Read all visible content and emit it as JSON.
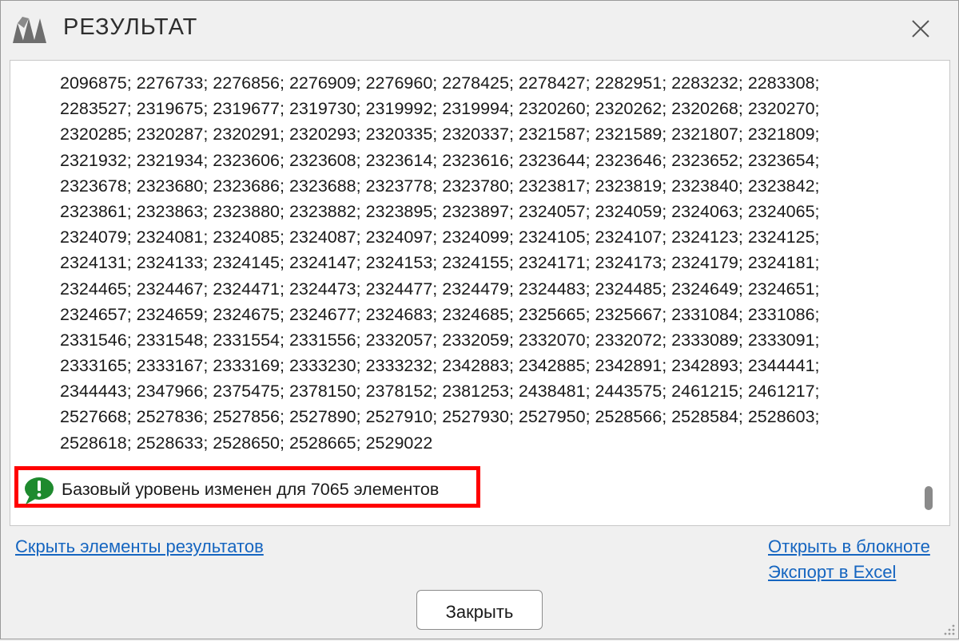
{
  "window": {
    "title": "РЕЗУЛЬТАТ",
    "logo_icon": "app-logo-icon",
    "close_icon": "close-icon"
  },
  "result": {
    "lines": [
      "2096875; 2276733; 2276856; 2276909; 2276960; 2278425; 2278427; 2282951; 2283232; 2283308;",
      "2283527; 2319675; 2319677; 2319730; 2319992; 2319994; 2320260; 2320262; 2320268; 2320270;",
      "2320285; 2320287; 2320291; 2320293; 2320335; 2320337; 2321587; 2321589; 2321807; 2321809;",
      "2321932; 2321934; 2323606; 2323608; 2323614; 2323616; 2323644; 2323646; 2323652; 2323654;",
      "2323678; 2323680; 2323686; 2323688; 2323778; 2323780; 2323817; 2323819; 2323840; 2323842;",
      "2323861; 2323863; 2323880; 2323882; 2323895; 2323897; 2324057; 2324059; 2324063; 2324065;",
      "2324079; 2324081; 2324085; 2324087; 2324097; 2324099; 2324105; 2324107; 2324123; 2324125;",
      "2324131; 2324133; 2324145; 2324147; 2324153; 2324155; 2324171; 2324173; 2324179; 2324181;",
      "2324465; 2324467; 2324471; 2324473; 2324477; 2324479; 2324483; 2324485; 2324649; 2324651;",
      "2324657; 2324659; 2324675; 2324677; 2324683; 2324685; 2325665; 2325667; 2331084; 2331086;",
      "2331546; 2331548; 2331554; 2331556; 2332057; 2332059; 2332070; 2332072; 2333089; 2333091;",
      "2333165; 2333167; 2333169; 2333230; 2333232; 2342883; 2342885; 2342891; 2342893; 2344441;",
      "2344443; 2347966; 2375475; 2378150; 2378152; 2381253; 2438481; 2443575; 2461215; 2461217;",
      "2527668; 2527836; 2527856; 2527890; 2527910; 2527930; 2527950; 2528566; 2528584; 2528603;",
      "2528618; 2528633; 2528650; 2528665; 2529022"
    ],
    "message": "Базовый уровень изменен для 7065 элементов",
    "message_icon": "success-alert-icon",
    "message_icon_color": "#1e8a2e",
    "highlight_color": "#ff0000"
  },
  "footer": {
    "hide_link": "Скрыть элементы результатов",
    "notepad_link": "Открыть в блокноте",
    "excel_link": "Экспорт в Excel",
    "close_button": "Закрыть"
  }
}
